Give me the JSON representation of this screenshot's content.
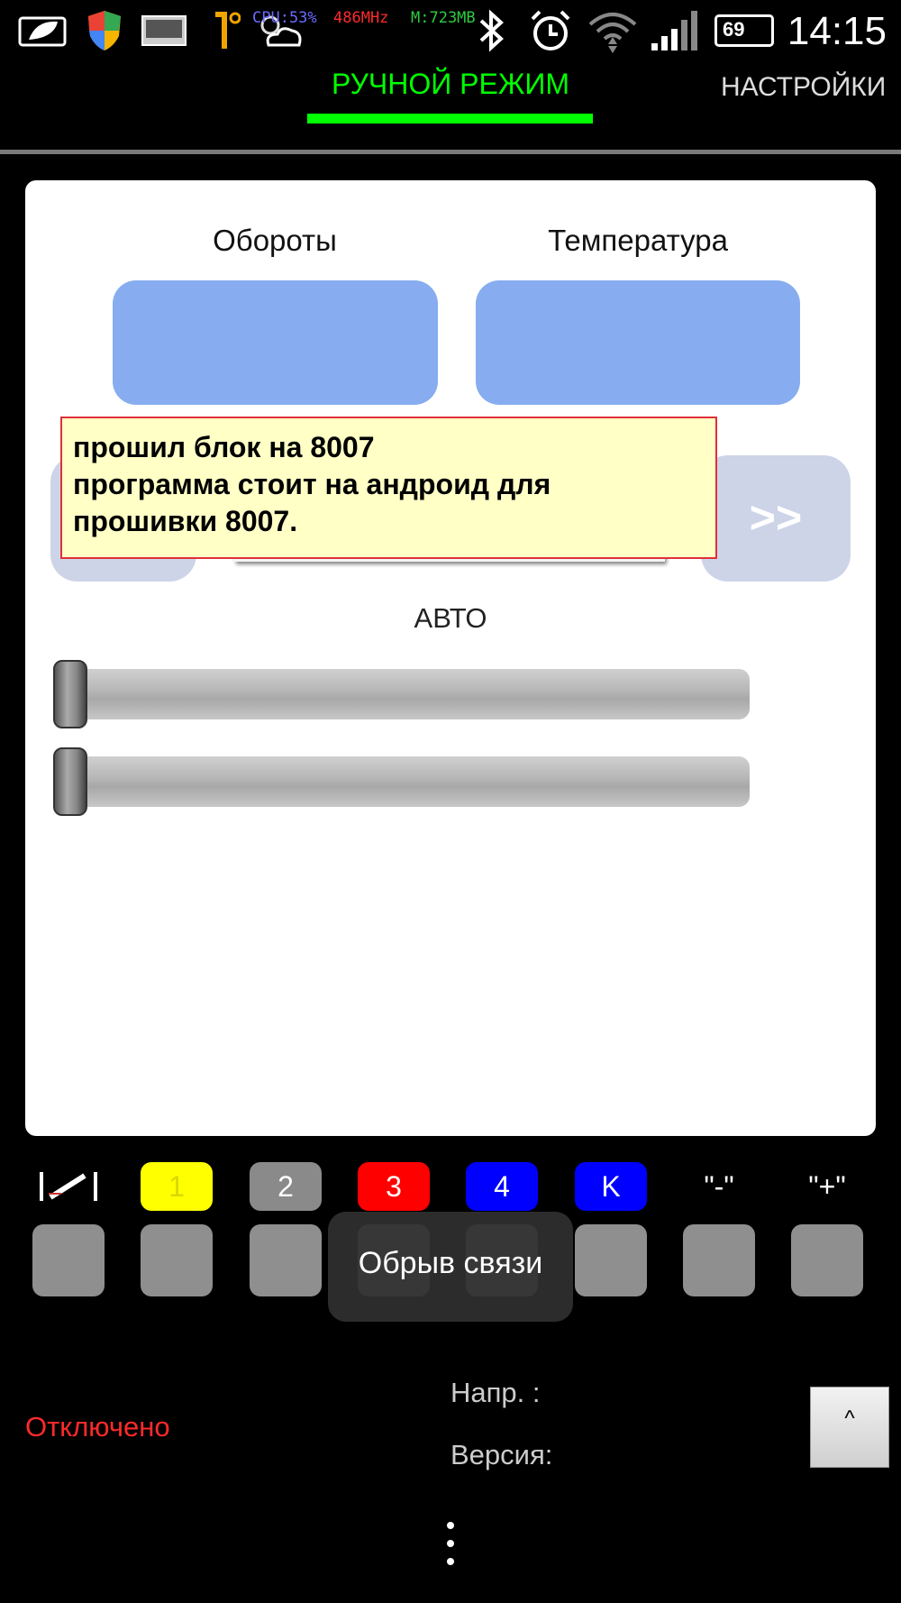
{
  "status_bar": {
    "cpu": "CPU:53%",
    "freq": "486MHz",
    "mem": "M:723MB",
    "battery": "69",
    "time": "14:15",
    "icons": [
      "leaf-notification-icon",
      "shield-icon",
      "screenshot-icon",
      "usb-icon",
      "weather-icon",
      "bluetooth-icon",
      "alarm-icon",
      "wifi-icon",
      "signal-icon",
      "battery-icon"
    ]
  },
  "tabs": {
    "active": "РУЧНОЙ РЕЖИМ",
    "next": "НАСТРОЙКИ",
    "accent_color": "#00ff00"
  },
  "panel": {
    "gauges": [
      {
        "label": "Обороты",
        "value": ""
      },
      {
        "label": "Температура",
        "value": ""
      }
    ],
    "next_button": ">>",
    "note": {
      "lines": [
        "прошил блок на 8007",
        "программа стоит на андроид для",
        "прошивки 8007."
      ]
    },
    "auto_label": "АВТО",
    "sliders": [
      {
        "value": 0
      },
      {
        "value": 0
      }
    ]
  },
  "channels": {
    "labels": [
      "",
      "1",
      "2",
      "3",
      "4",
      "K",
      "\"-\"",
      "\"+\""
    ],
    "colors": [
      "#000000",
      "#ffff00",
      "#8a8a8a",
      "#ff0000",
      "#0000ff",
      "#0000ff",
      "#000000",
      "#000000"
    ],
    "text_colors": [
      "#ffffff",
      "#d8d800",
      "#ffffff",
      "#ffffff",
      "#ffffff",
      "#ffffff",
      "#ffffff",
      "#ffffff"
    ]
  },
  "toast": "Обрыв связи",
  "footer": {
    "connection_status": "Отключено",
    "voltage_label": "Напр. :",
    "version_label": "Версия:",
    "up_button": "^",
    "status_color": "#ff2a2a"
  }
}
